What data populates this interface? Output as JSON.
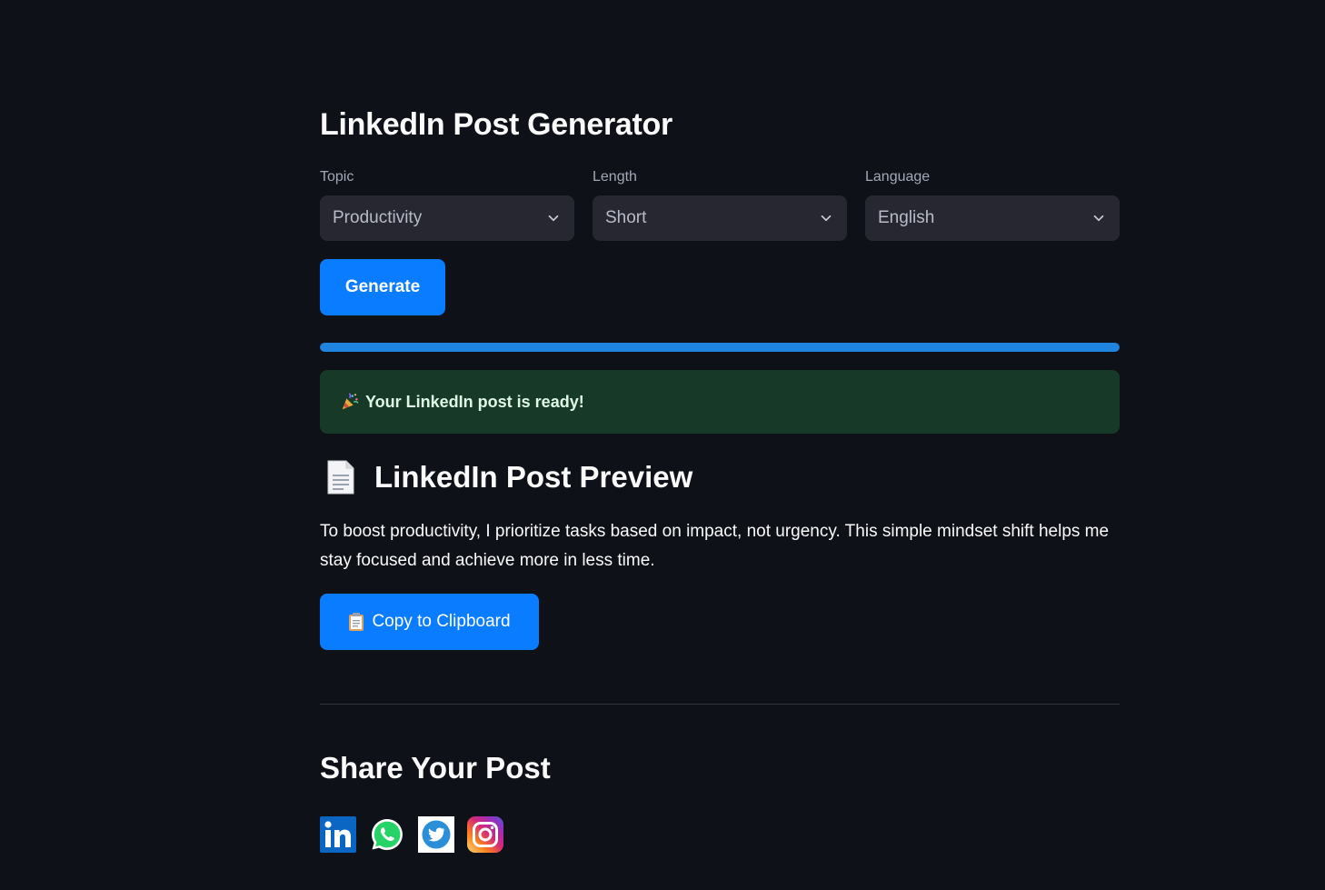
{
  "header": {
    "title": "LinkedIn Post Generator"
  },
  "filters": {
    "topic": {
      "label": "Topic",
      "value": "Productivity"
    },
    "length": {
      "label": "Length",
      "value": "Short"
    },
    "language": {
      "label": "Language",
      "value": "English"
    }
  },
  "actions": {
    "generate_label": "Generate",
    "copy_label": "Copy to Clipboard"
  },
  "progress": {
    "value_percent": 100,
    "color": "#1f83e0"
  },
  "status": {
    "message": "Your LinkedIn post is ready!",
    "icon": "party-popper-icon",
    "background": "#173928"
  },
  "preview": {
    "title": "LinkedIn Post Preview",
    "icon": "document-icon",
    "text": "To boost productivity, I prioritize tasks based on impact, not urgency. This simple mindset shift helps me stay focused and achieve more in less time."
  },
  "share": {
    "title": "Share Your Post",
    "icons": [
      "linkedin-icon",
      "whatsapp-icon",
      "twitter-icon",
      "instagram-icon"
    ]
  },
  "colors": {
    "background": "#0e1117",
    "primary": "#0a7cff",
    "input": "#262730"
  }
}
